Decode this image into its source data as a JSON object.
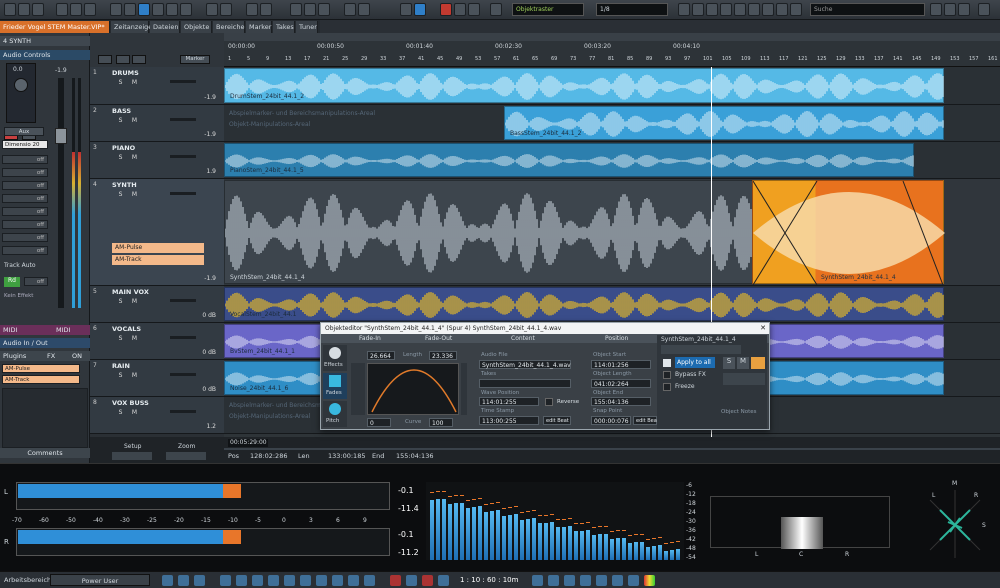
{
  "window": {
    "title": "Frieder Vogel STEM Master.VIP*"
  },
  "top_tabs": [
    "Zeitanzeige",
    "Dateien",
    "Objekte",
    "Bereiche",
    "Marker",
    "Takes",
    "Tuner"
  ],
  "toolbar": {
    "grid_label": "Objektraster",
    "quantize": "1/8",
    "search_placeholder": "Suche"
  },
  "left_panel": {
    "track_label": "4  SYNTH",
    "audio_controls": "Audio Controls",
    "fader_values": [
      "0.0",
      "-1.9"
    ],
    "aux_label": "Aux",
    "dimension_label": "Dimensio",
    "dimension_value": "20",
    "off_labels": [
      "off",
      "off",
      "off",
      "off",
      "off",
      "off",
      "off",
      "off"
    ],
    "track_auto": "Track  Auto",
    "rd": "Rd",
    "off_small": "off",
    "kein_effekt": "Kein Effekt",
    "midi": "MIDI",
    "midi2": "MIDI",
    "audio_inout": "Audio In / Out",
    "plugins": "Plugins",
    "fx": "FX",
    "on": "ON",
    "plugin_list": [
      "AM-Pulse",
      "AM-Track"
    ],
    "comments": "Comments"
  },
  "tracks": [
    {
      "num": "1",
      "name": "DRUMS",
      "vol": "-1.9",
      "clip": "DrumStem_24bit_44.1_2",
      "note1": "",
      "note2": ""
    },
    {
      "num": "2",
      "name": "BASS",
      "vol": "-1.9",
      "clip": "BassStem_24bit_44.1_2",
      "note1": "Abspielmarker- und Bereichsmanipulations-Areal",
      "note2": "Objekt-Manipulations-Areal"
    },
    {
      "num": "3",
      "name": "PIANO",
      "vol": "1.9",
      "clip": "PianoStem_24bit_44.1_5",
      "note1": "",
      "note2": ""
    },
    {
      "num": "4",
      "name": "SYNTH",
      "vol": "-1.9",
      "clip": "SynthStem_24bit_44.1_4",
      "clip2": "SynthStem_24bit_44.1_4",
      "fx1": "AM-Pulse",
      "fx2": "AM-Track"
    },
    {
      "num": "5",
      "name": "MAIN VOX",
      "vol": "0 dB",
      "clip": "VocalStem_24bit_44.1"
    },
    {
      "num": "6",
      "name": "VOCALS",
      "vol": "0 dB",
      "clip": "BvStem_24bit_44.1_1"
    },
    {
      "num": "7",
      "name": "RAIN",
      "vol": "0 dB",
      "clip": "Noise_24bit_44.1_6"
    },
    {
      "num": "8",
      "name": "VOX BUSS",
      "vol": "1.2",
      "clip": "",
      "note1": "Abspielmarker- und Bereichsmanipulations-Areal",
      "note2": "Objekt-Manipulations-Areal"
    }
  ],
  "ruler": {
    "times": [
      "00:00:00",
      "00:00:50",
      "00:01:40",
      "00:02:30",
      "00:03:20",
      "00:04:10"
    ],
    "bars": [
      "1",
      "5",
      "9",
      "13",
      "17",
      "21",
      "25",
      "29",
      "33",
      "37",
      "41",
      "45",
      "49",
      "53",
      "57",
      "61",
      "65",
      "69",
      "73",
      "77",
      "81",
      "85",
      "89",
      "93",
      "97",
      "101",
      "105",
      "109",
      "113",
      "117",
      "121",
      "125",
      "129",
      "133",
      "137",
      "141",
      "145",
      "149",
      "153",
      "157",
      "161"
    ]
  },
  "status": {
    "setup": "Setup",
    "zoom": "Zoom",
    "pos_label": "Pos",
    "pos": "128:02:286",
    "len_label": "Len",
    "len": "133:00:185",
    "end_label": "End",
    "end": "155:04:136",
    "time": "00:05:29:00"
  },
  "object_editor": {
    "title": "Objekteditor \"SynthStem_24bit_44.1_4\" (Spur 4)  SynthStem_24bit_44.1_4.wav",
    "sections": [
      "Fade-In",
      "Fade-Out",
      "Content",
      "Position"
    ],
    "side_tabs": [
      "Effects",
      "Fades",
      "Pitch"
    ],
    "fade_in": "26.664",
    "length_label": "Length",
    "fade_len": "23.336",
    "curve_label": "Curve",
    "curve_left": "0",
    "curve": "100",
    "audio_file_label": "Audio File",
    "audio_file": "SynthStem_24bit_44.1_4.wav",
    "takes_label": "Takes",
    "wave_pos_label": "Wave Position",
    "wave_pos": "114:01:255",
    "time_stamp_label": "Time Stamp",
    "time_stamp": "113:00:255",
    "reverse": "Reverse",
    "obj_start_label": "Object Start",
    "obj_start": "114:01:256",
    "obj_len_label": "Object Length",
    "obj_len": "041:02:264",
    "obj_end_label": "Object End",
    "obj_end": "155:04:136",
    "snap_label": "Snap Point",
    "snap": "000:00:076",
    "edit_beat": "edit Beat",
    "right_title": "SynthStem_24bit_44.1_4",
    "apply_all": "Apply to all",
    "bypass": "Bypass FX",
    "freeze": "Freeze",
    "notes": "Object Notes"
  },
  "meters": {
    "left_vals": [
      "-0.1",
      "-11.4",
      "-0.1",
      "-11.2"
    ],
    "scale": [
      "-70",
      "-60",
      "-50",
      "-40",
      "-30",
      "-25",
      "-20",
      "-15",
      "-10",
      "-5",
      "0",
      "3",
      "6",
      "9"
    ],
    "spectrum_scale": [
      "-6",
      "-12",
      "-18",
      "-24",
      "-30",
      "-36",
      "-42",
      "-48",
      "-54"
    ],
    "channels": [
      "L",
      "R"
    ],
    "stereo_labels": [
      "L",
      "C",
      "R"
    ],
    "gonio_labels": [
      "M",
      "L",
      "R",
      "S"
    ],
    "level_L": 0.74,
    "level_R": 0.74
  },
  "footer": {
    "workspace_label": "Arbeitsbereich:",
    "workspace": "Power User",
    "counter": "1 : 10 : 60 : 10m"
  }
}
